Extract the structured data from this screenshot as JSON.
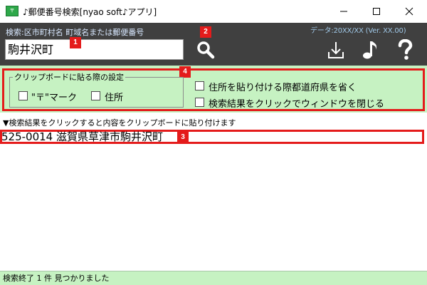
{
  "window": {
    "icon_text": "〒",
    "title": "♪郵便番号検索[nyao soft♪アプリ]"
  },
  "header": {
    "search_label": "検索:区市町村名  町域名または郵便番号",
    "data_version": "データ:20XX/XX  (Ver. XX.00)",
    "search_value": "駒井沢町"
  },
  "icons": {
    "search": "search-icon",
    "download": "download-icon",
    "music": "music-note-icon",
    "help": "question-icon"
  },
  "badges": [
    "1",
    "2",
    "3",
    "4"
  ],
  "settings": {
    "group_title": "クリップボードに貼る際の設定",
    "opt_mark": "\"〒\"マーク",
    "opt_address": "住所",
    "opt_omit_pref": "住所を貼り付ける際都道府県を省く",
    "opt_close": "検索結果をクリックでウィンドウを閉じる",
    "checked": {
      "mark": false,
      "address": false,
      "omit_pref": false,
      "close": false
    }
  },
  "results": {
    "hint": "▼検索結果をクリックすると内容をクリップボードに貼り付けます",
    "items": [
      "525-0014 滋賀県草津市駒井沢町"
    ]
  },
  "status": {
    "text": "検索終了  1 件 見つかりました"
  },
  "colors": {
    "header_bg": "#404040",
    "panel_bg": "#c6f2c2",
    "highlight": "#e41b1b"
  }
}
